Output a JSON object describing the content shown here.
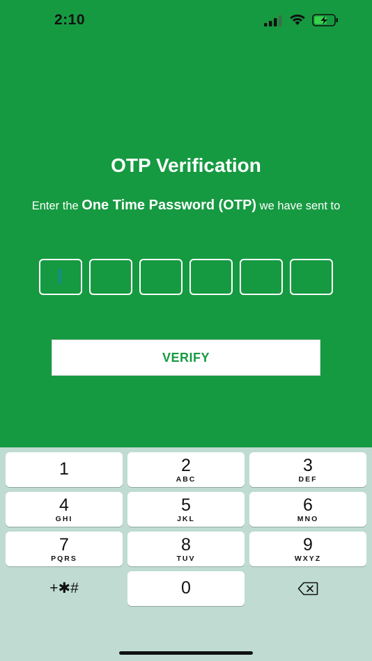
{
  "status_bar": {
    "time": "2:10"
  },
  "page": {
    "title": "OTP Verification",
    "subtitle_prefix": "Enter the ",
    "subtitle_strong": "One Time Password (OTP)",
    "subtitle_suffix": " we have sent to",
    "verify_label": "VERIFY"
  },
  "otp": {
    "digits": [
      "",
      "",
      "",
      "",
      "",
      ""
    ]
  },
  "keypad": {
    "keys": [
      {
        "num": "1",
        "letters": ""
      },
      {
        "num": "2",
        "letters": "ABC"
      },
      {
        "num": "3",
        "letters": "DEF"
      },
      {
        "num": "4",
        "letters": "GHI"
      },
      {
        "num": "5",
        "letters": "JKL"
      },
      {
        "num": "6",
        "letters": "MNO"
      },
      {
        "num": "7",
        "letters": "PQRS"
      },
      {
        "num": "8",
        "letters": "TUV"
      },
      {
        "num": "9",
        "letters": "WXYZ"
      },
      {
        "num": "0",
        "letters": ""
      }
    ],
    "symbols_label": "+✱#"
  },
  "colors": {
    "primary": "#169a41",
    "keypad_bg": "#c0dcd2",
    "caret": "#1e7ad8"
  }
}
